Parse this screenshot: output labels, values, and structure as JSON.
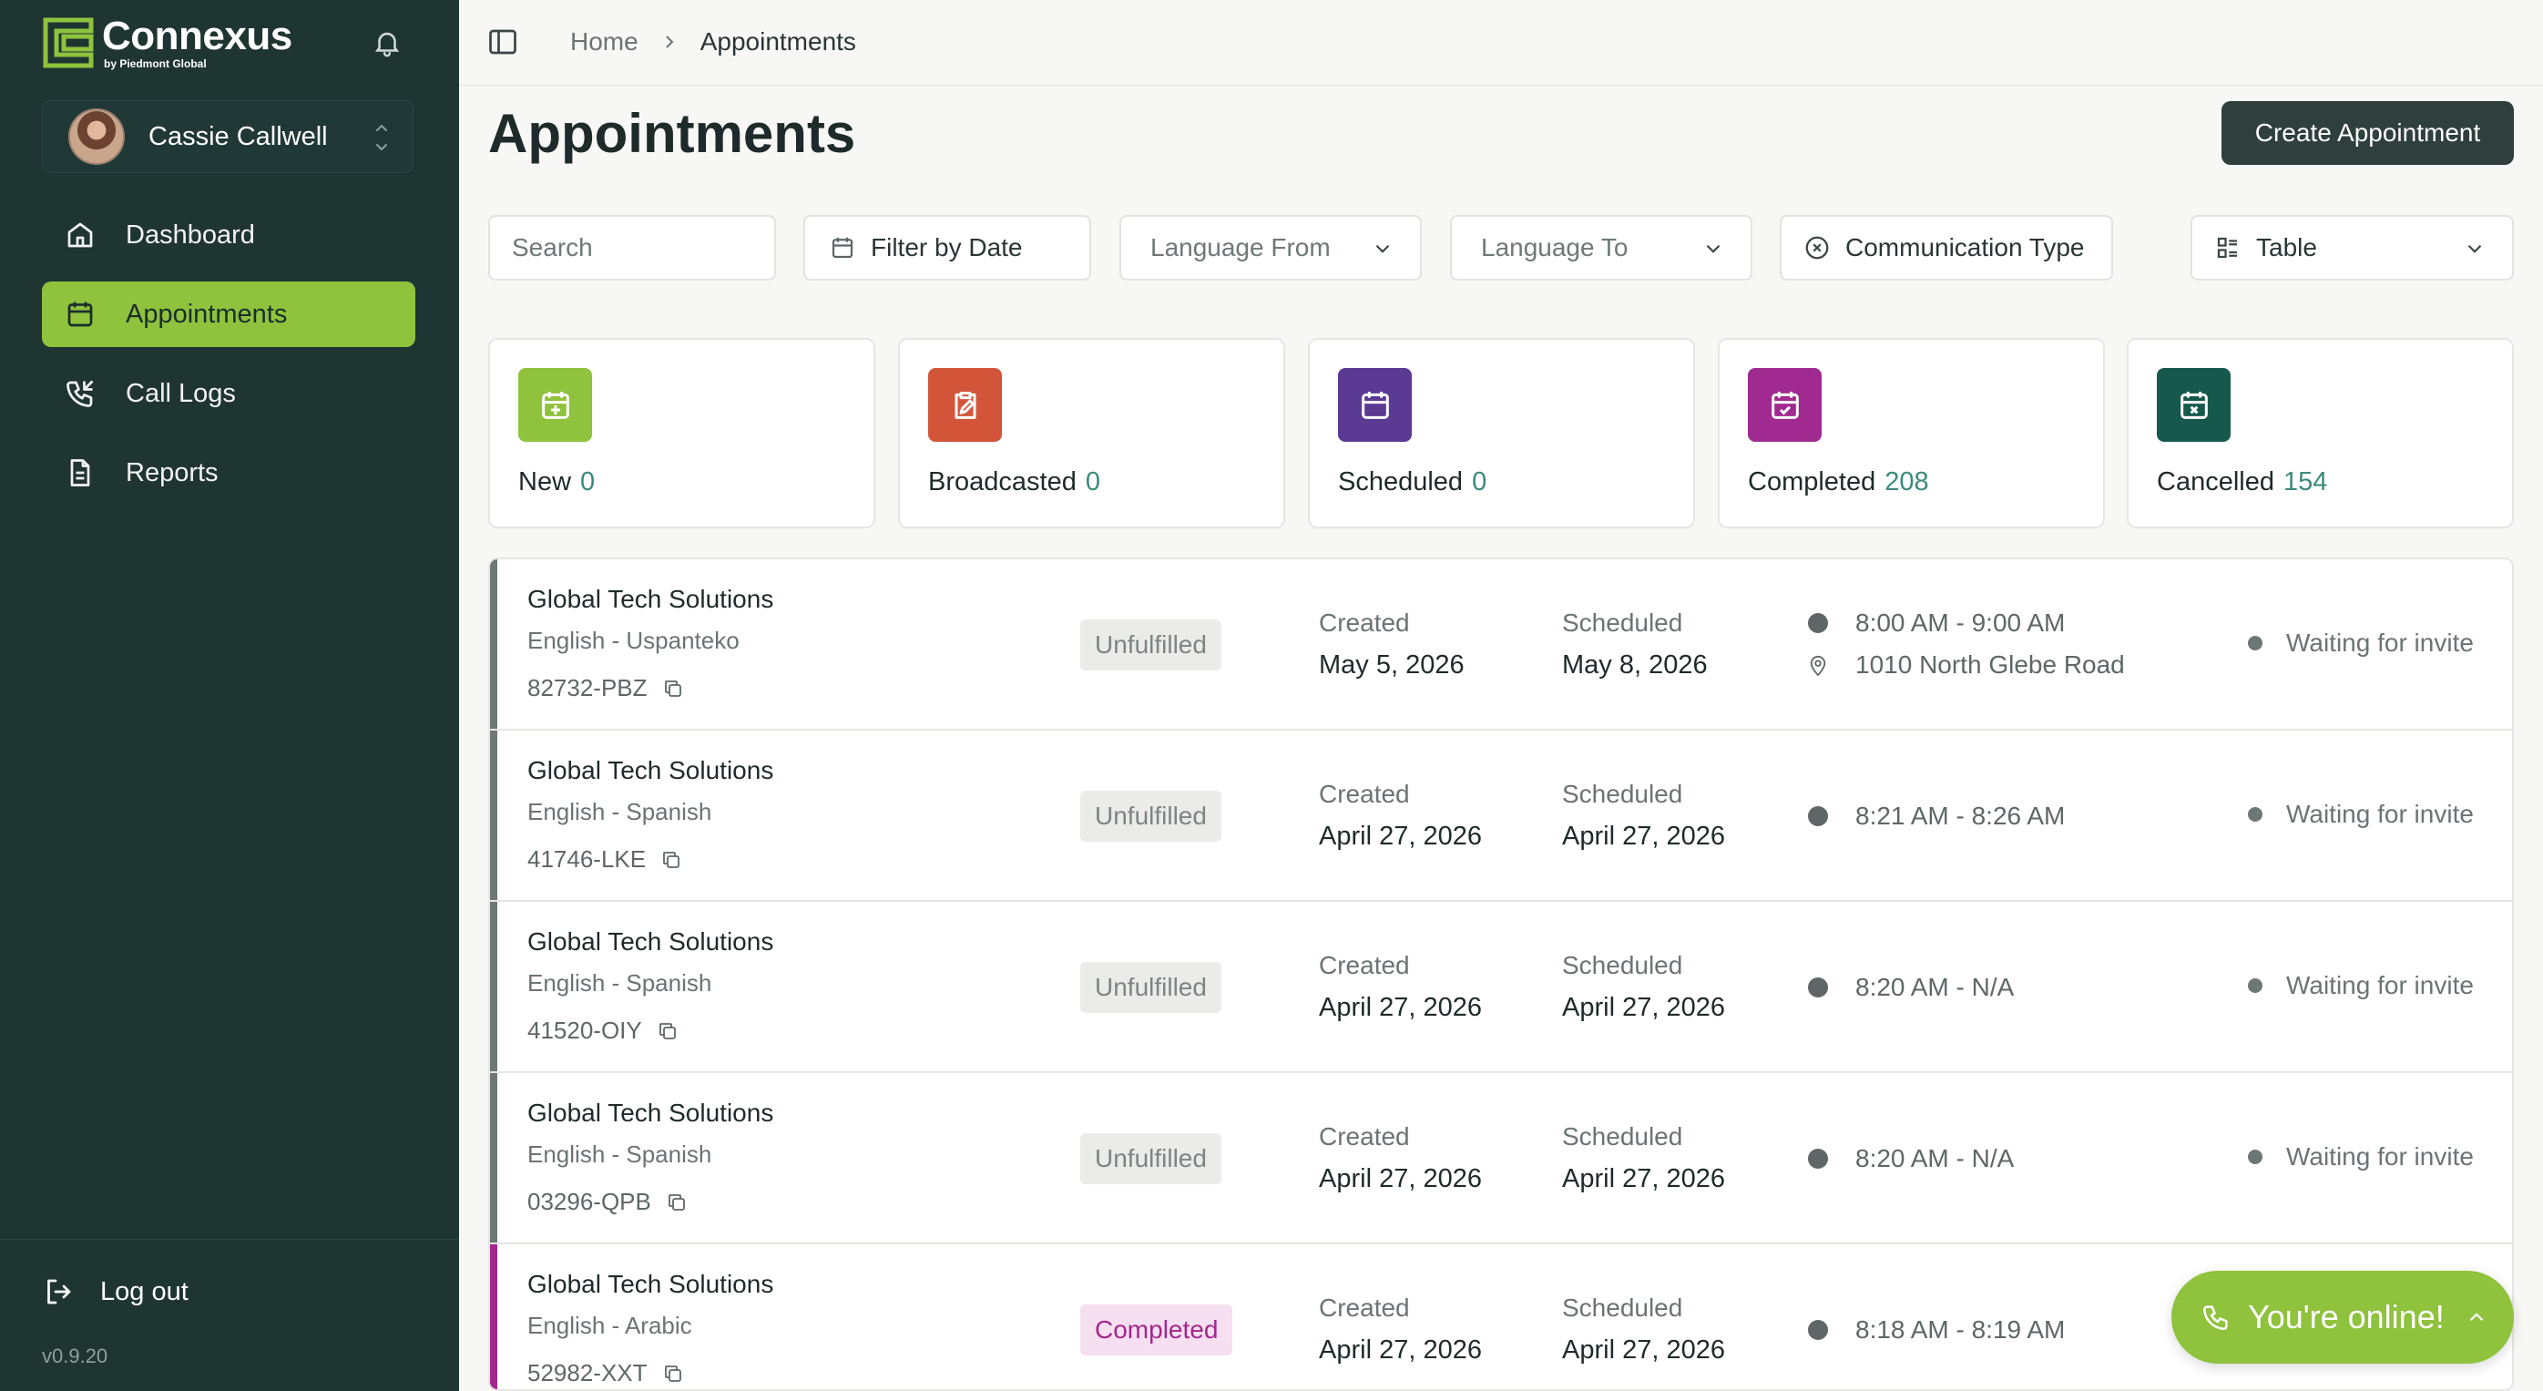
{
  "app": {
    "brand": "Connexus",
    "brand_sub": "by Piedmont Global",
    "user_name": "Cassie Callwell",
    "version": "v0.9.20"
  },
  "nav": {
    "dashboard": "Dashboard",
    "appointments": "Appointments",
    "call_logs": "Call Logs",
    "reports": "Reports",
    "logout": "Log out"
  },
  "breadcrumb": {
    "home": "Home",
    "current": "Appointments"
  },
  "page": {
    "title": "Appointments",
    "create_label": "Create Appointment"
  },
  "filters": {
    "search_placeholder": "Search",
    "date": "Filter by Date",
    "language_from": "Language From",
    "language_to": "Language To",
    "communication_type": "Communication Type",
    "view": "Table"
  },
  "stats": [
    {
      "label": "New",
      "count": "0",
      "color": "#8fc23d"
    },
    {
      "label": "Broadcasted",
      "count": "0",
      "color": "#d2553a"
    },
    {
      "label": "Scheduled",
      "count": "0",
      "color": "#5b3a93"
    },
    {
      "label": "Completed",
      "count": "208",
      "color": "#a02a90"
    },
    {
      "label": "Cancelled",
      "count": "154",
      "color": "#17584d"
    }
  ],
  "appointments": [
    {
      "company": "Global Tech Solutions",
      "languages": "English - Uspanteko",
      "code": "82732-PBZ",
      "status": "Unfulfilled",
      "created_label": "Created",
      "created": "May 5, 2026",
      "scheduled_label": "Scheduled",
      "scheduled": "May 8, 2026",
      "time": "8:00 AM - 9:00 AM",
      "address": "1010 North Glebe Road",
      "invite": "Waiting for invite"
    },
    {
      "company": "Global Tech Solutions",
      "languages": "English - Spanish",
      "code": "41746-LKE",
      "status": "Unfulfilled",
      "created_label": "Created",
      "created": "April 27, 2026",
      "scheduled_label": "Scheduled",
      "scheduled": "April 27, 2026",
      "time": "8:21 AM - 8:26 AM",
      "invite": "Waiting for invite"
    },
    {
      "company": "Global Tech Solutions",
      "languages": "English - Spanish",
      "code": "41520-OIY",
      "status": "Unfulfilled",
      "created_label": "Created",
      "created": "April 27, 2026",
      "scheduled_label": "Scheduled",
      "scheduled": "April 27, 2026",
      "time": "8:20 AM - N/A",
      "invite": "Waiting for invite"
    },
    {
      "company": "Global Tech Solutions",
      "languages": "English - Spanish",
      "code": "03296-QPB",
      "status": "Unfulfilled",
      "created_label": "Created",
      "created": "April 27, 2026",
      "scheduled_label": "Scheduled",
      "scheduled": "April 27, 2026",
      "time": "8:20 AM - N/A",
      "invite": "Waiting for invite"
    },
    {
      "company": "Global Tech Solutions",
      "languages": "English - Arabic",
      "code": "52982-XXT",
      "status": "Completed",
      "created_label": "Created",
      "created": "April 27, 2026",
      "scheduled_label": "Scheduled",
      "scheduled": "April 27, 2026",
      "time": "8:18 AM - 8:19 AM"
    }
  ],
  "online": {
    "label": "You're online!"
  },
  "colors": {
    "sidebar": "#1f3532",
    "accent": "#8fc23d",
    "completed": "#a2278d",
    "primary_button": "#2f3f3d"
  }
}
